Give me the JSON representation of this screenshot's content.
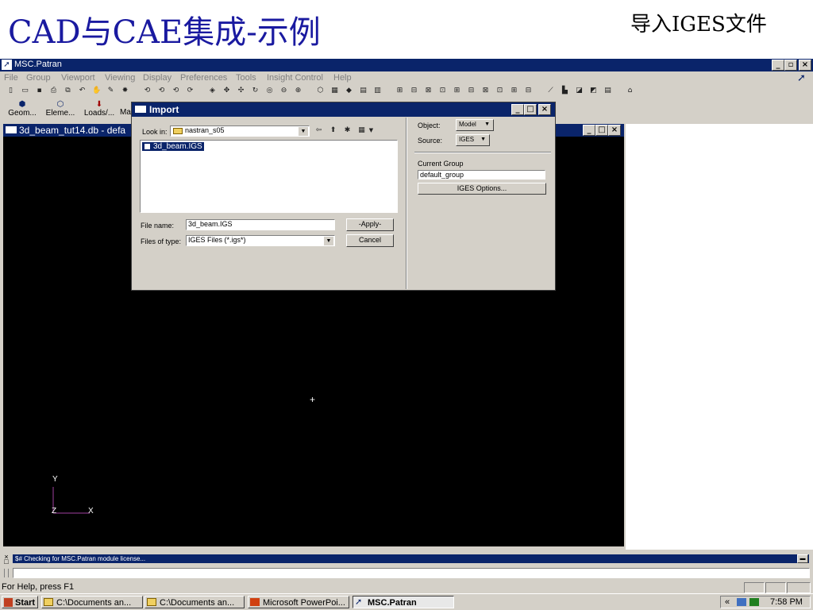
{
  "slide": {
    "title": "CAD与CAE集成-示例",
    "subtitle": "导入IGES文件"
  },
  "app": {
    "title": "MSC.Patran",
    "menu": [
      "File",
      "Group",
      "Viewport",
      "Viewing",
      "Display",
      "Preferences",
      "Tools",
      "Insight Control",
      "Help"
    ],
    "app_buttons": [
      "Geom...",
      "Eleme...",
      "Loads/...",
      "Ma"
    ]
  },
  "viewport": {
    "title": "3d_beam_tut14.db - defa",
    "axis_y": "Y",
    "axis_z": "Z",
    "axis_x": "X",
    "crosshair": "+"
  },
  "dialog": {
    "title": "Import",
    "look_in_label": "Look in:",
    "look_in_value": "nastran_s05",
    "file_list": [
      "3d_beam.IGS"
    ],
    "file_name_label": "File name:",
    "file_name_value": "3d_beam.IGS",
    "file_type_label": "Files of type:",
    "file_type_value": "IGES Files (*.igs*)",
    "apply_label": "-Apply-",
    "cancel_label": "Cancel",
    "object_label": "Object:",
    "object_value": "Model",
    "source_label": "Source:",
    "source_value": "IGES",
    "current_group_label": "Current Group",
    "current_group_value": "default_group",
    "iges_options_label": "IGES Options..."
  },
  "messages": {
    "log_text": "$# Checking for MSC.Patran module license...",
    "status_text": "For Help, press F1"
  },
  "taskbar": {
    "start_label": "Start",
    "tasks": [
      "C:\\Documents an...",
      "C:\\Documents an...",
      "Microsoft PowerPoi...",
      "MSC.Patran"
    ],
    "clock": "7:58 PM",
    "tray_chevron": "«"
  },
  "colors": {
    "title_blue": "#1a1aa0",
    "window_active": "#0a246a",
    "face": "#d4d0c8",
    "viewport_bg": "#000000",
    "axis_color": "#a040a0"
  }
}
